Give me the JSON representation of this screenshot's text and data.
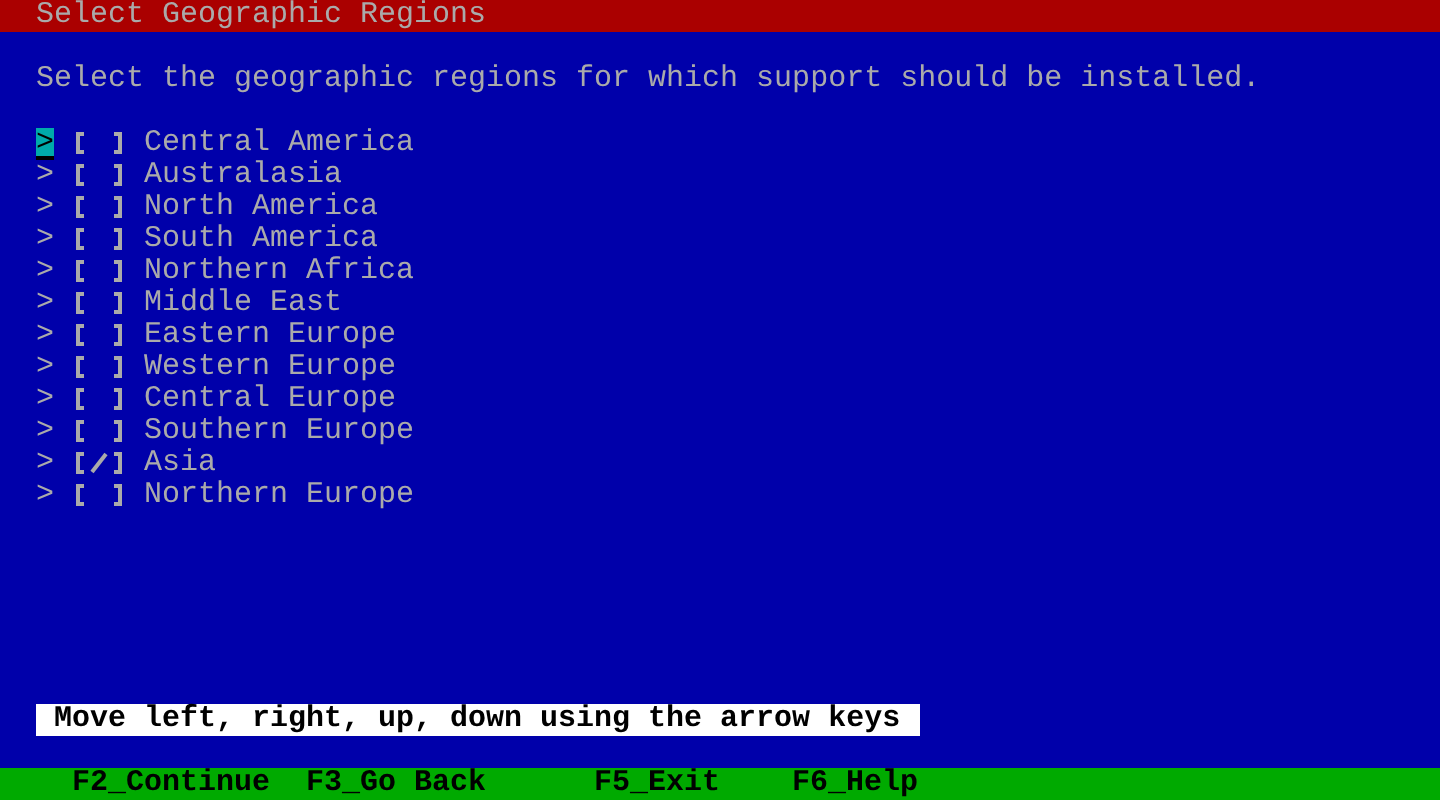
{
  "window": {
    "title": "Select Geographic Regions"
  },
  "instruction": "Select the geographic regions for which support should be installed.",
  "regions": [
    {
      "marker": ">",
      "label": "Central America",
      "checked": false,
      "selected": true
    },
    {
      "marker": ">",
      "label": "Australasia",
      "checked": false,
      "selected": false
    },
    {
      "marker": ">",
      "label": "North America",
      "checked": false,
      "selected": false
    },
    {
      "marker": ">",
      "label": "South America",
      "checked": false,
      "selected": false
    },
    {
      "marker": ">",
      "label": "Northern Africa",
      "checked": false,
      "selected": false
    },
    {
      "marker": ">",
      "label": "Middle East",
      "checked": false,
      "selected": false
    },
    {
      "marker": ">",
      "label": "Eastern Europe",
      "checked": false,
      "selected": false
    },
    {
      "marker": ">",
      "label": "Western Europe",
      "checked": false,
      "selected": false
    },
    {
      "marker": ">",
      "label": "Central Europe",
      "checked": false,
      "selected": false
    },
    {
      "marker": ">",
      "label": "Southern Europe",
      "checked": false,
      "selected": false
    },
    {
      "marker": ">",
      "label": "Asia",
      "checked": true,
      "selected": false
    },
    {
      "marker": ">",
      "label": "Northern Europe",
      "checked": false,
      "selected": false
    }
  ],
  "help_text": "Move left, right, up, down using the arrow keys",
  "function_keys": [
    "F2_Continue",
    "F3_Go Back",
    "F5_Exit",
    "F6_Help"
  ]
}
